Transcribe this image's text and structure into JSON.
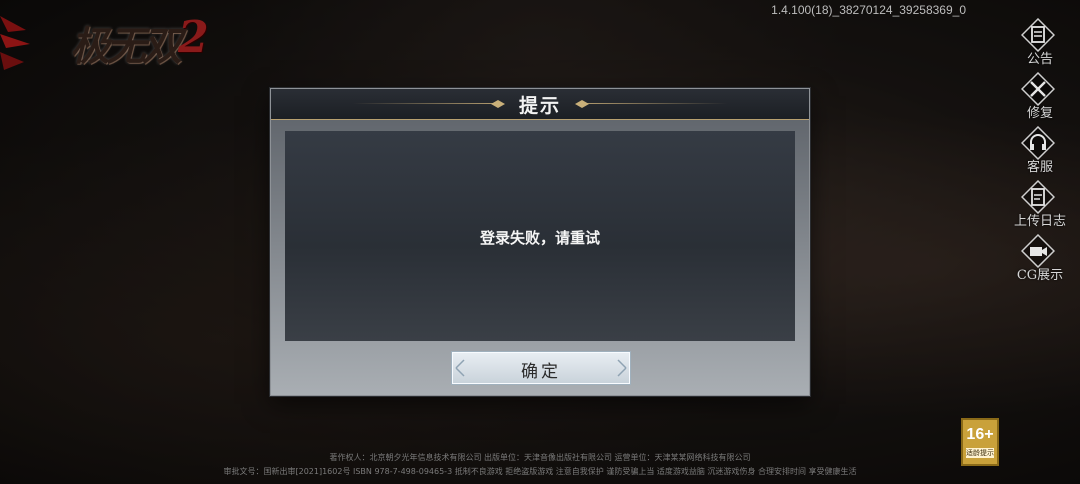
{
  "app": {
    "logo_text": "极无双",
    "logo_number": "2",
    "version": "1.4.100(18)_38270124_39258369_0"
  },
  "side_menu": [
    {
      "label": "公告",
      "icon": "notice-icon"
    },
    {
      "label": "修复",
      "icon": "repair-tools-icon"
    },
    {
      "label": "客服",
      "icon": "headset-icon"
    },
    {
      "label": "上传日志",
      "icon": "upload-log-icon"
    },
    {
      "label": "CG展示",
      "icon": "video-camera-icon"
    }
  ],
  "dialog": {
    "title": "提示",
    "message": "登录失败，请重试",
    "confirm_label": "确定"
  },
  "footer": {
    "line1": "著作权人：北京朝夕光年信息技术有限公司 出版单位：天津音像出版社有限公司 运营单位：天津某某网络科技有限公司",
    "line2": "审批文号：国新出审[2021]1602号 ISBN 978-7-498-09465-3 抵制不良游戏 拒绝盗版游戏 注意自我保护 谨防受骗上当 适度游戏益脑 沉迷游戏伤身 合理安排时间 享受健康生活",
    "age_rating": "16+",
    "age_label": "适龄提示"
  },
  "colors": {
    "accent_gold": "#b8a070",
    "age_badge": "#c9a13a",
    "logo_red": "#8a1a1a"
  }
}
